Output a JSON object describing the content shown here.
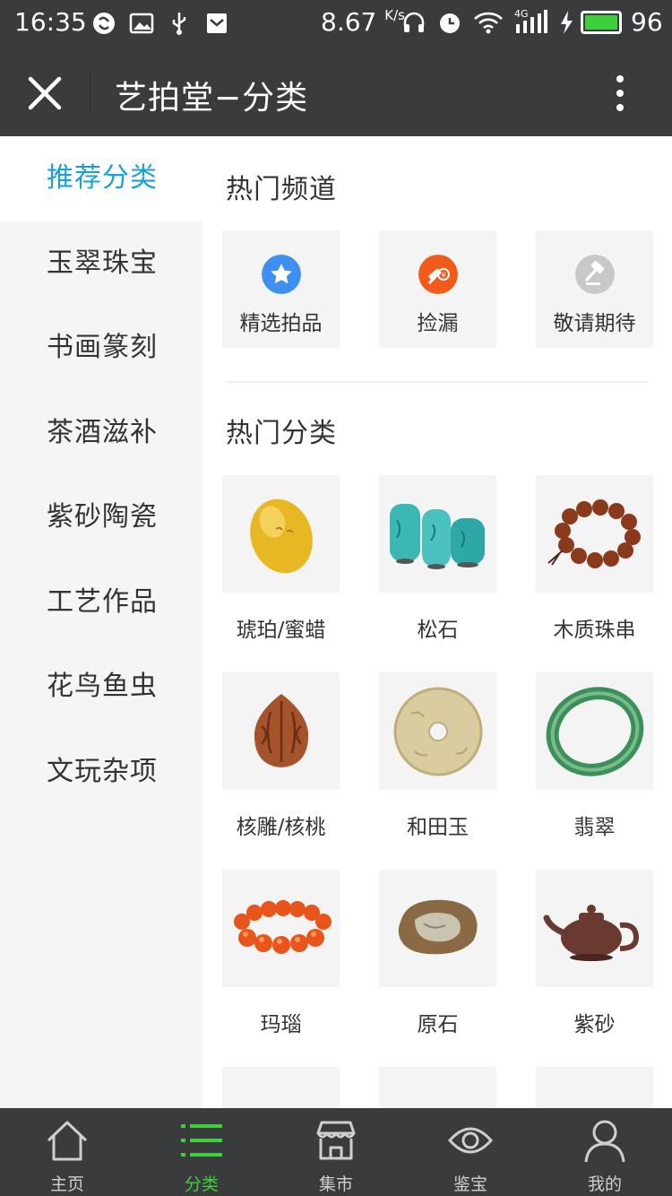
{
  "status_bar": {
    "time": "16:35",
    "speed": "8.67",
    "speed_unit": "K/s",
    "network": "4G",
    "battery_level": "96",
    "battery_color": "#3ed03a"
  },
  "title_bar": {
    "title": "艺拍堂−分类",
    "close_icon": "close-icon",
    "more_icon": "more-vertical-icon"
  },
  "sidebar": {
    "items": [
      {
        "label": "推荐分类",
        "active": true
      },
      {
        "label": "玉翠珠宝"
      },
      {
        "label": "书画篆刻"
      },
      {
        "label": "茶酒滋补"
      },
      {
        "label": "紫砂陶瓷"
      },
      {
        "label": "工艺作品"
      },
      {
        "label": "花鸟鱼虫"
      },
      {
        "label": "文玩杂项"
      }
    ],
    "active_color": "#1aa0d8"
  },
  "main": {
    "hot_channels": {
      "title": "热门频道",
      "items": [
        {
          "label": "精选拍品",
          "icon": "star-icon",
          "color": "#3d8ff0"
        },
        {
          "label": "捡漏",
          "icon": "auction-icon",
          "color": "#f25a1a"
        },
        {
          "label": "敬请期待",
          "icon": "gavel-icon",
          "color": "#c8c8c8"
        }
      ]
    },
    "hot_categories": {
      "title": "热门分类",
      "items": [
        {
          "label": "琥珀/蜜蜡",
          "image": "amber-image"
        },
        {
          "label": "松石",
          "image": "turquoise-image"
        },
        {
          "label": "木质珠串",
          "image": "wood-beads-image"
        },
        {
          "label": "核雕/核桃",
          "image": "walnut-image"
        },
        {
          "label": "和田玉",
          "image": "jade-disc-image"
        },
        {
          "label": "翡翠",
          "image": "jadeite-bangle-image"
        },
        {
          "label": "玛瑙",
          "image": "agate-bracelet-image"
        },
        {
          "label": "原石",
          "image": "raw-stone-image"
        },
        {
          "label": "紫砂",
          "image": "zisha-teapot-image"
        }
      ]
    }
  },
  "bottom_nav": {
    "items": [
      {
        "label": "主页",
        "icon": "home-icon"
      },
      {
        "label": "分类",
        "icon": "list-icon",
        "active": true
      },
      {
        "label": "集市",
        "icon": "shop-icon"
      },
      {
        "label": "鉴宝",
        "icon": "eye-icon"
      },
      {
        "label": "我的",
        "icon": "user-icon"
      }
    ],
    "active_color": "#3ed03a"
  }
}
